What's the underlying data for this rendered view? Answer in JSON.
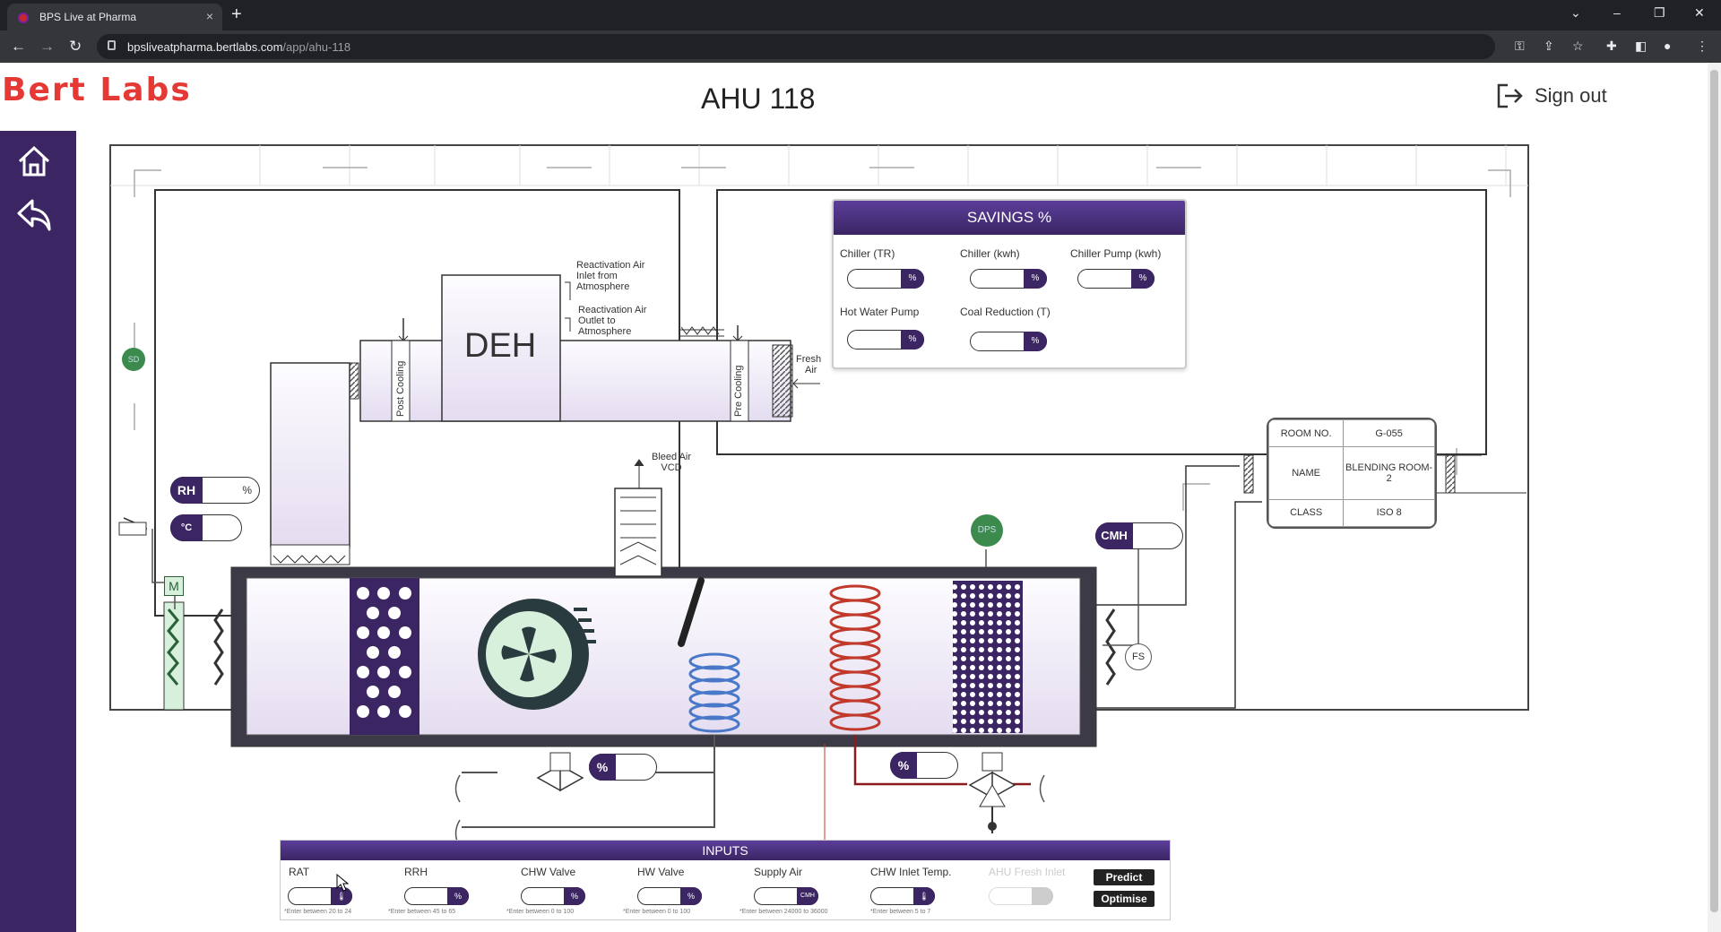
{
  "browser": {
    "tab_title": "BPS Live at Pharma",
    "tab_close": "×",
    "new_tab": "+",
    "url_host": "bpsliveatpharma.bertlabs.com",
    "url_path": "/app/ahu-118",
    "win_minimize": "–",
    "win_restore": "❐",
    "win_close": "✕",
    "back": "←",
    "forward": "→",
    "reload": "↻"
  },
  "header": {
    "logo": "Bert Labs",
    "title": "AHU 118",
    "signout": "Sign out"
  },
  "diagram": {
    "deh": "DEH",
    "reactivation_inlet": [
      "Reactivation Air",
      "Inlet from",
      "Atmosphere"
    ],
    "reactivation_outlet": [
      "Reactivation Air",
      "Outlet to",
      "Atmosphere"
    ],
    "post_cooling": "Post Cooling",
    "pre_cooling": "Pre Cooling",
    "fresh_air": [
      "Fresh",
      "Air"
    ],
    "bleed_air": [
      "Bleed Air",
      "VCD"
    ],
    "sd": "SD",
    "rh": "RH",
    "rh_unit": "%",
    "temp_unit": "°C",
    "m": "M",
    "dps": "DPS",
    "cmh": "CMH",
    "fs": "FS",
    "pct": "%"
  },
  "savings": {
    "title": "SAVINGS %",
    "items": [
      {
        "label": "Chiller (TR)",
        "unit": "%"
      },
      {
        "label": "Chiller (kwh)",
        "unit": "%"
      },
      {
        "label": "Chiller Pump (kwh)",
        "unit": "%"
      },
      {
        "label": "Hot Water Pump",
        "unit": "%"
      },
      {
        "label": "Coal Reduction (T)",
        "unit": "%"
      }
    ]
  },
  "room": {
    "rows": [
      {
        "key": "ROOM NO.",
        "value": "G-055"
      },
      {
        "key": "NAME",
        "value": "BLENDING ROOM-2"
      },
      {
        "key": "CLASS",
        "value": "ISO 8"
      }
    ]
  },
  "inputs": {
    "title": "INPUTS",
    "fields": [
      {
        "label": "RAT",
        "unit": "🌡",
        "hint": "*Enter between 20 to 24"
      },
      {
        "label": "RRH",
        "unit": "%",
        "hint": "*Enter between 45 to 65"
      },
      {
        "label": "CHW Valve",
        "unit": "%",
        "hint": "*Enter between 0 to 100"
      },
      {
        "label": "HW Valve",
        "unit": "%",
        "hint": "*Enter between 0 to 100"
      },
      {
        "label": "Supply Air",
        "unit": "CMH",
        "hint": "*Enter between 24000 to 36000"
      },
      {
        "label": "CHW Inlet Temp.",
        "unit": "🌡",
        "hint": "*Enter between 5 to 7"
      },
      {
        "label": "AHU Fresh Inlet",
        "unit": "",
        "hint": ""
      }
    ],
    "predict": "Predict",
    "optimise": "Optimise"
  },
  "colors": {
    "brand": "#e53935",
    "sidebar": "#3b2563",
    "panel_header": "#4a2f85"
  }
}
